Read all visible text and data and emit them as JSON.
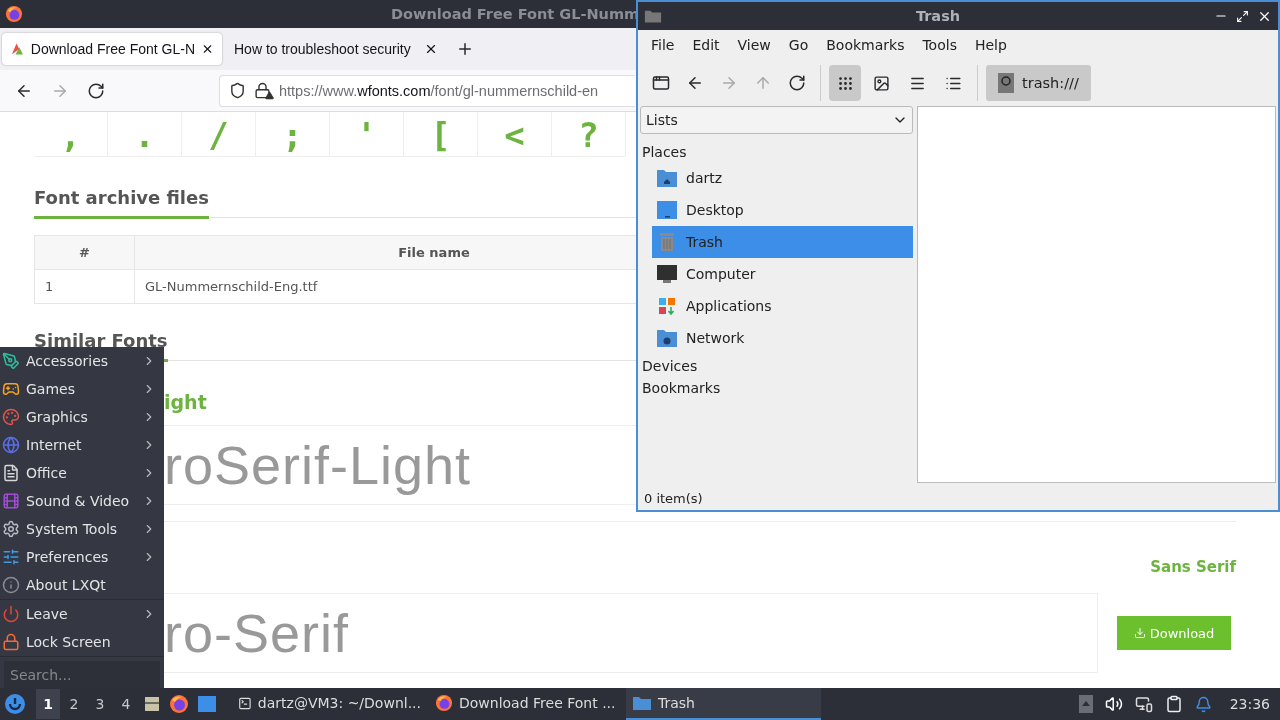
{
  "browser": {
    "title": "Download Free Font GL-Numm",
    "tabs": [
      {
        "title": "Download Free Font GL-N",
        "selected": true
      },
      {
        "title": "How to troubleshoot security",
        "selected": false
      }
    ],
    "nav_buttons": [
      {
        "kind": "back",
        "disabled": false
      },
      {
        "kind": "forward",
        "disabled": true
      },
      {
        "kind": "reload",
        "disabled": false
      }
    ],
    "url": {
      "scheme": "https://www.",
      "domain": "wfonts.com",
      "path": "/font/gl-nummernschild-en"
    },
    "page": {
      "glyphs": [
        ",",
        ".",
        "/",
        ";",
        "'",
        "[",
        "<",
        "?"
      ],
      "archive": {
        "heading": "Font archive files",
        "columns": [
          "#",
          "File name"
        ],
        "rows": [
          [
            "1",
            "GL-Nummernschild-Eng.ttf"
          ]
        ]
      },
      "similar": {
        "heading": "Similar Fonts",
        "fonts": [
          {
            "title": "ight",
            "preview": "roSerif-Light"
          },
          {
            "category": "Sans Serif",
            "preview": "ro-Serif",
            "button": "Download"
          }
        ]
      }
    }
  },
  "file_manager": {
    "title": "Trash",
    "menu": [
      "File",
      "Edit",
      "View",
      "Go",
      "Bookmarks",
      "Tools",
      "Help"
    ],
    "nav_buttons": [
      {
        "kind": "new_tab",
        "disabled": false
      },
      {
        "kind": "back",
        "disabled": false
      },
      {
        "kind": "forward",
        "disabled": true
      },
      {
        "kind": "up",
        "disabled": true
      },
      {
        "kind": "reload",
        "disabled": false
      }
    ],
    "view_buttons": [
      {
        "kind": "icons",
        "selected": true
      },
      {
        "kind": "thumbnails",
        "selected": false
      },
      {
        "kind": "compact",
        "selected": false
      },
      {
        "kind": "detailed",
        "selected": false
      }
    ],
    "location": "trash:///",
    "side_dropdown": "Lists",
    "sections": [
      {
        "title": "Places",
        "items": [
          {
            "label": "dartz",
            "selected": false
          },
          {
            "label": "Desktop",
            "selected": false
          },
          {
            "label": "Trash",
            "selected": true
          },
          {
            "label": "Computer",
            "selected": false
          },
          {
            "label": "Applications",
            "selected": false
          },
          {
            "label": "Network",
            "selected": false
          }
        ]
      },
      {
        "title": "Devices"
      },
      {
        "title": "Bookmarks"
      }
    ],
    "status": "0 item(s)"
  },
  "start_menu": {
    "groups": [
      {
        "items": [
          {
            "label": "Accessories",
            "kind": "submenu"
          },
          {
            "label": "Games",
            "kind": "submenu"
          },
          {
            "label": "Graphics",
            "kind": "submenu"
          },
          {
            "label": "Internet",
            "kind": "submenu"
          },
          {
            "label": "Office",
            "kind": "submenu"
          },
          {
            "label": "Sound & Video",
            "kind": "submenu"
          },
          {
            "label": "System Tools",
            "kind": "submenu"
          },
          {
            "label": "Preferences",
            "kind": "submenu"
          },
          {
            "label": "About LXQt",
            "kind": "action"
          }
        ]
      },
      {
        "items": [
          {
            "label": "Leave",
            "kind": "submenu"
          },
          {
            "label": "Lock Screen",
            "kind": "action"
          }
        ]
      }
    ],
    "search": {
      "placeholder": "Search..."
    }
  },
  "taskbar": {
    "desktops": [
      {
        "label": "1",
        "selected": true
      },
      {
        "label": "2",
        "selected": false
      },
      {
        "label": "3",
        "selected": false
      },
      {
        "label": "4",
        "selected": false
      }
    ],
    "tasks": [
      {
        "title": "dartz@VM3: ~/Downl...",
        "kind": "terminal",
        "selected": false
      },
      {
        "title": "Download Free Font ...",
        "kind": "browser",
        "selected": false
      },
      {
        "title": "Trash",
        "kind": "folder",
        "selected": true
      }
    ],
    "clock": "23:36"
  }
}
